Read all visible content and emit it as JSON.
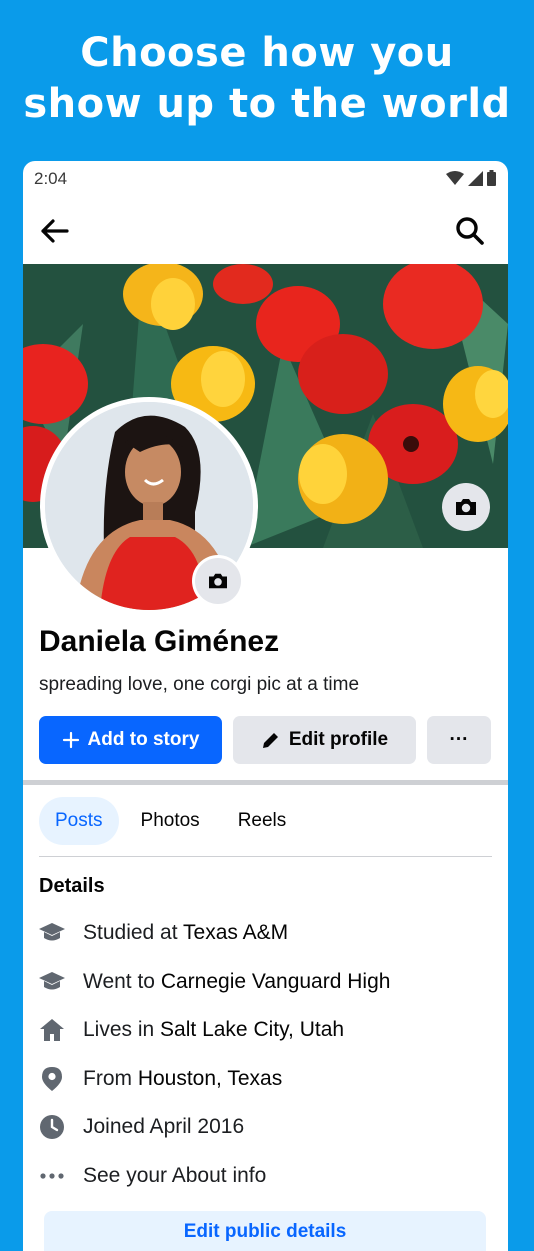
{
  "headline": {
    "line1": "Choose how you",
    "line2": "show up to the world"
  },
  "status_bar": {
    "time": "2:04"
  },
  "profile": {
    "name": "Daniela Giménez",
    "bio": "spreading love, one corgi pic at a time"
  },
  "actions": {
    "add_to_story": "Add to story",
    "edit_profile": "Edit profile",
    "more": "···"
  },
  "tabs": [
    {
      "label": "Posts",
      "active": true
    },
    {
      "label": "Photos",
      "active": false
    },
    {
      "label": "Reels",
      "active": false
    }
  ],
  "details": {
    "title": "Details",
    "items": [
      {
        "icon": "graduation-cap-icon",
        "prefix": "Studied at ",
        "value": "Texas A&M"
      },
      {
        "icon": "graduation-cap-icon",
        "prefix": "Went to ",
        "value": "Carnegie Vanguard High"
      },
      {
        "icon": "home-icon",
        "prefix": "Lives in ",
        "value": "Salt Lake City, Utah"
      },
      {
        "icon": "location-pin-icon",
        "prefix": "From ",
        "value": "Houston, Texas"
      },
      {
        "icon": "clock-icon",
        "prefix": "Joined April 2016",
        "value": ""
      },
      {
        "icon": "more-dots-icon",
        "prefix": "See your About info",
        "value": ""
      }
    ],
    "edit_button": "Edit public details"
  },
  "colors": {
    "background": "#0a9bea",
    "primary": "#0866ff",
    "secondary_button": "#e4e6eb",
    "active_tab_bg": "#e7f3ff"
  }
}
